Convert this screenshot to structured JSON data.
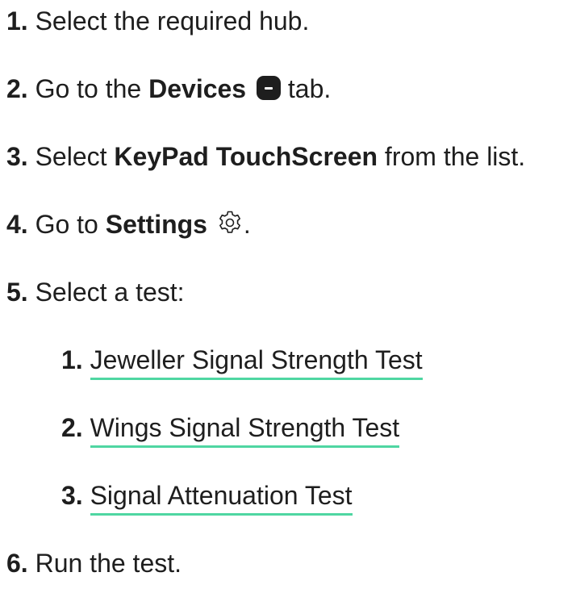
{
  "steps": [
    {
      "num": "1.",
      "text": "Select the required hub."
    },
    {
      "num": "2.",
      "pre": "Go to the",
      "bold": "Devices",
      "icon": "devices-tab-icon",
      "post": "tab."
    },
    {
      "num": "3.",
      "pre": "Select",
      "bold": "KeyPad TouchScreen",
      "post": "from the list."
    },
    {
      "num": "4.",
      "pre": "Go to",
      "bold": "Settings",
      "icon": "gear-icon",
      "post": "."
    },
    {
      "num": "5.",
      "text": "Select a test:"
    },
    {
      "num": "6.",
      "text": "Run the test."
    }
  ],
  "substeps": [
    {
      "num": "1.",
      "label": "Jeweller Signal Strength Test"
    },
    {
      "num": "2.",
      "label": "Wings Signal Strength Test"
    },
    {
      "num": "3.",
      "label": "Signal Attenuation Test"
    }
  ],
  "colors": {
    "text": "#1e1e1e",
    "link_underline": "#4fd6a2"
  }
}
